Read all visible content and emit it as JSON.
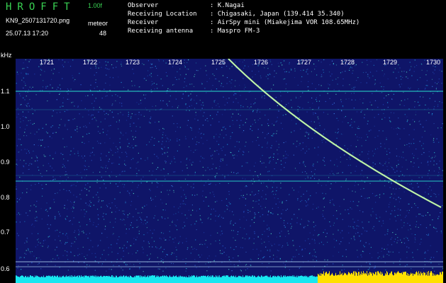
{
  "header": {
    "logo": "HROFFT",
    "version": "1.00f",
    "filename": "KN9_2507131720.png",
    "mode": "meteor",
    "datetime": "25.07.13 17:20",
    "count": "48"
  },
  "info": [
    {
      "label": "Observer",
      "value": ": K.Nagai"
    },
    {
      "label": "Receiving Location",
      "value": ": Chigasaki, Japan (139.414 35.340)"
    },
    {
      "label": "Receiver",
      "value": ": AirSpy mini (Miakejima VOR 108.65MHz)"
    },
    {
      "label": "Receiving antenna",
      "value": ": Maspro FM-3"
    }
  ],
  "axes": {
    "unit": "kHz",
    "y_ticks": [
      "1.1",
      "1.0",
      "0.9",
      "0.8",
      "0.7",
      "0.6"
    ],
    "x_ticks": [
      "1721",
      "1722",
      "1723",
      "1724",
      "1725",
      "1726",
      "1727",
      "1728",
      "1729",
      "1730"
    ]
  },
  "colors": {
    "text_green": "#39d353",
    "text_white": "#ffffff",
    "background": "#0f1568",
    "signal": "#2ad4c8",
    "trace": "#b8ff90",
    "noise": "#ffe000"
  }
}
